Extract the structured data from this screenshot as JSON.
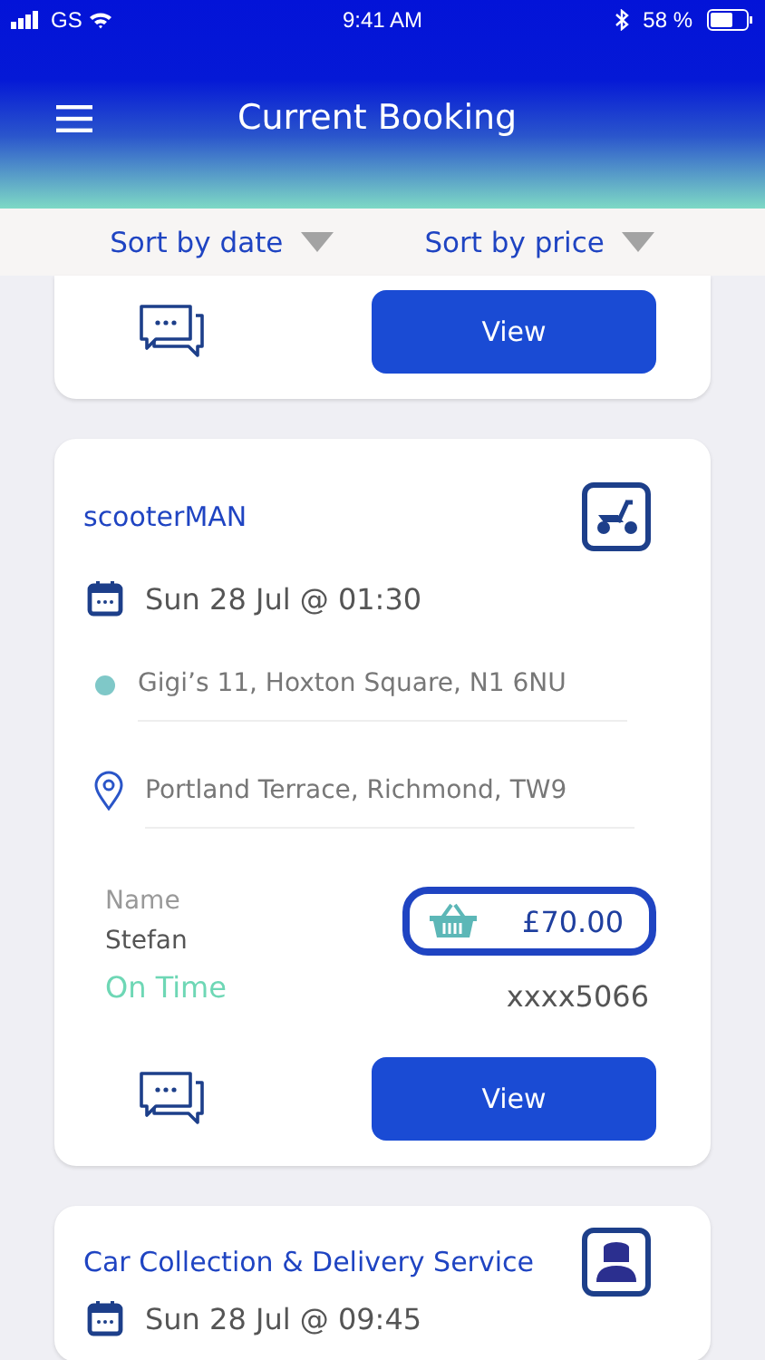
{
  "status_bar": {
    "carrier": "GS",
    "time": "9:41 AM",
    "battery": "58 %"
  },
  "header": {
    "title": "Current Booking"
  },
  "sort": [
    {
      "label": "Sort by date"
    },
    {
      "label": "Sort by price"
    }
  ],
  "bookings": [
    {
      "partial": true,
      "button": "View"
    },
    {
      "service": "scooterMAN",
      "kind": "scooter",
      "date": "Sun 28 Jul @ 01:30",
      "pickup": "Gigi’s 11, Hoxton Square, N1 6NU",
      "dropoff": "Portland Terrace, Richmond, TW9",
      "name_label": "Name",
      "name": "Stefan",
      "price": "£70.00",
      "status": "On Time",
      "card": "xxxx5066",
      "button": "View"
    },
    {
      "service": "Car Collection & Delivery Service",
      "kind": "driver",
      "date": "Sun 28 Jul @ 09:45"
    }
  ]
}
